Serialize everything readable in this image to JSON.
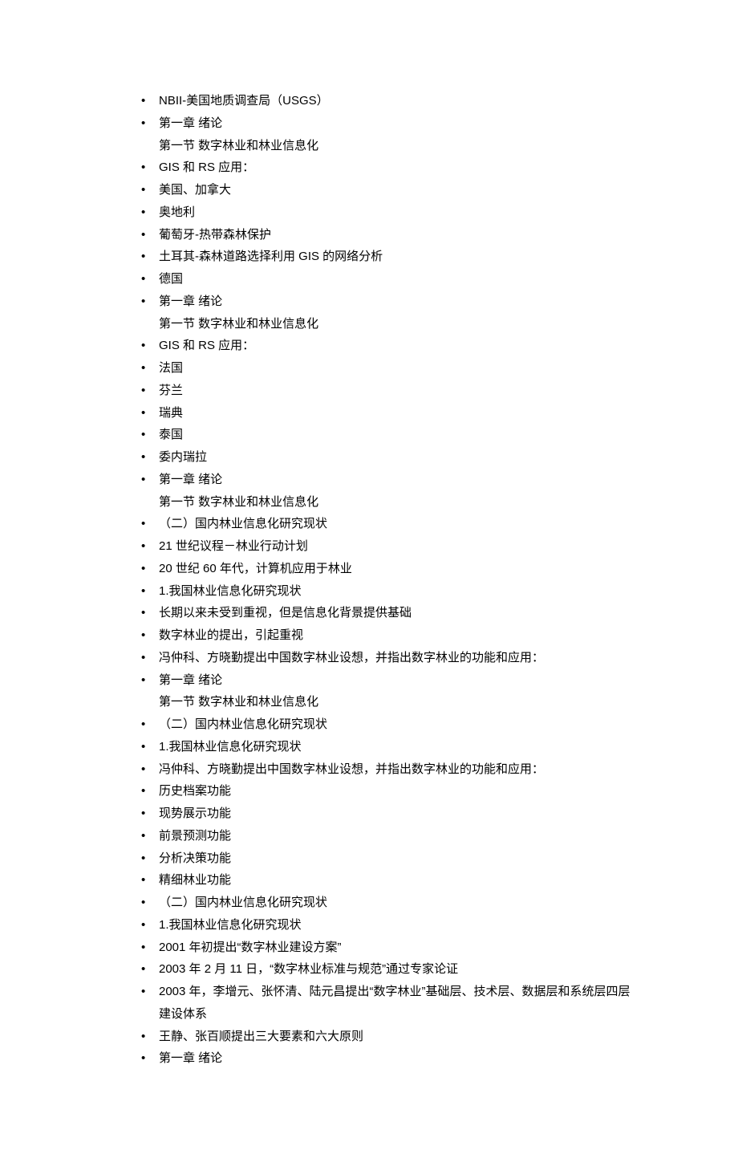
{
  "items": [
    {
      "text": "NBII-美国地质调查局（USGS）"
    },
    {
      "text": "第一章  绪论",
      "sub": "第一节  数字林业和林业信息化"
    },
    {
      "text": "GIS 和 RS 应用："
    },
    {
      "text": "美国、加拿大"
    },
    {
      "text": "奥地利"
    },
    {
      "text": "葡萄牙-热带森林保护"
    },
    {
      "text": "土耳其-森林道路选择利用 GIS 的网络分析"
    },
    {
      "text": "德国"
    },
    {
      "text": "第一章  绪论",
      "sub": "第一节  数字林业和林业信息化"
    },
    {
      "text": "GIS 和 RS 应用："
    },
    {
      "text": "法国"
    },
    {
      "text": "芬兰"
    },
    {
      "text": "瑞典"
    },
    {
      "text": "泰国"
    },
    {
      "text": "委内瑞拉"
    },
    {
      "text": "第一章  绪论",
      "sub": "第一节  数字林业和林业信息化"
    },
    {
      "text": "（二）国内林业信息化研究现状"
    },
    {
      "text": "21 世纪议程－林业行动计划"
    },
    {
      "text": "20 世纪 60 年代，计算机应用于林业"
    },
    {
      "text": "1.我国林业信息化研究现状"
    },
    {
      "text": "长期以来未受到重视，但是信息化背景提供基础"
    },
    {
      "text": "数字林业的提出，引起重视"
    },
    {
      "text": "冯仲科、方晓勤提出中国数字林业设想，并指出数字林业的功能和应用："
    },
    {
      "text": "第一章  绪论",
      "sub": "第一节  数字林业和林业信息化"
    },
    {
      "text": "（二）国内林业信息化研究现状"
    },
    {
      "text": "1.我国林业信息化研究现状"
    },
    {
      "text": "冯仲科、方晓勤提出中国数字林业设想，并指出数字林业的功能和应用："
    },
    {
      "text": "历史档案功能"
    },
    {
      "text": "现势展示功能"
    },
    {
      "text": "前景预测功能"
    },
    {
      "text": "分析决策功能"
    },
    {
      "text": "精细林业功能"
    },
    {
      "text": "（二）国内林业信息化研究现状"
    },
    {
      "text": "1.我国林业信息化研究现状"
    },
    {
      "text": "2001 年初提出“数字林业建设方案”"
    },
    {
      "text": "2003 年 2 月 11 日，“数字林业标准与规范”通过专家论证"
    },
    {
      "text": "2003 年，李增元、张怀清、陆元昌提出“数字林业”基础层、技术层、数据层和系统层四层建设体系"
    },
    {
      "text": "王静、张百顺提出三大要素和六大原则"
    },
    {
      "text": "第一章  绪论"
    }
  ]
}
